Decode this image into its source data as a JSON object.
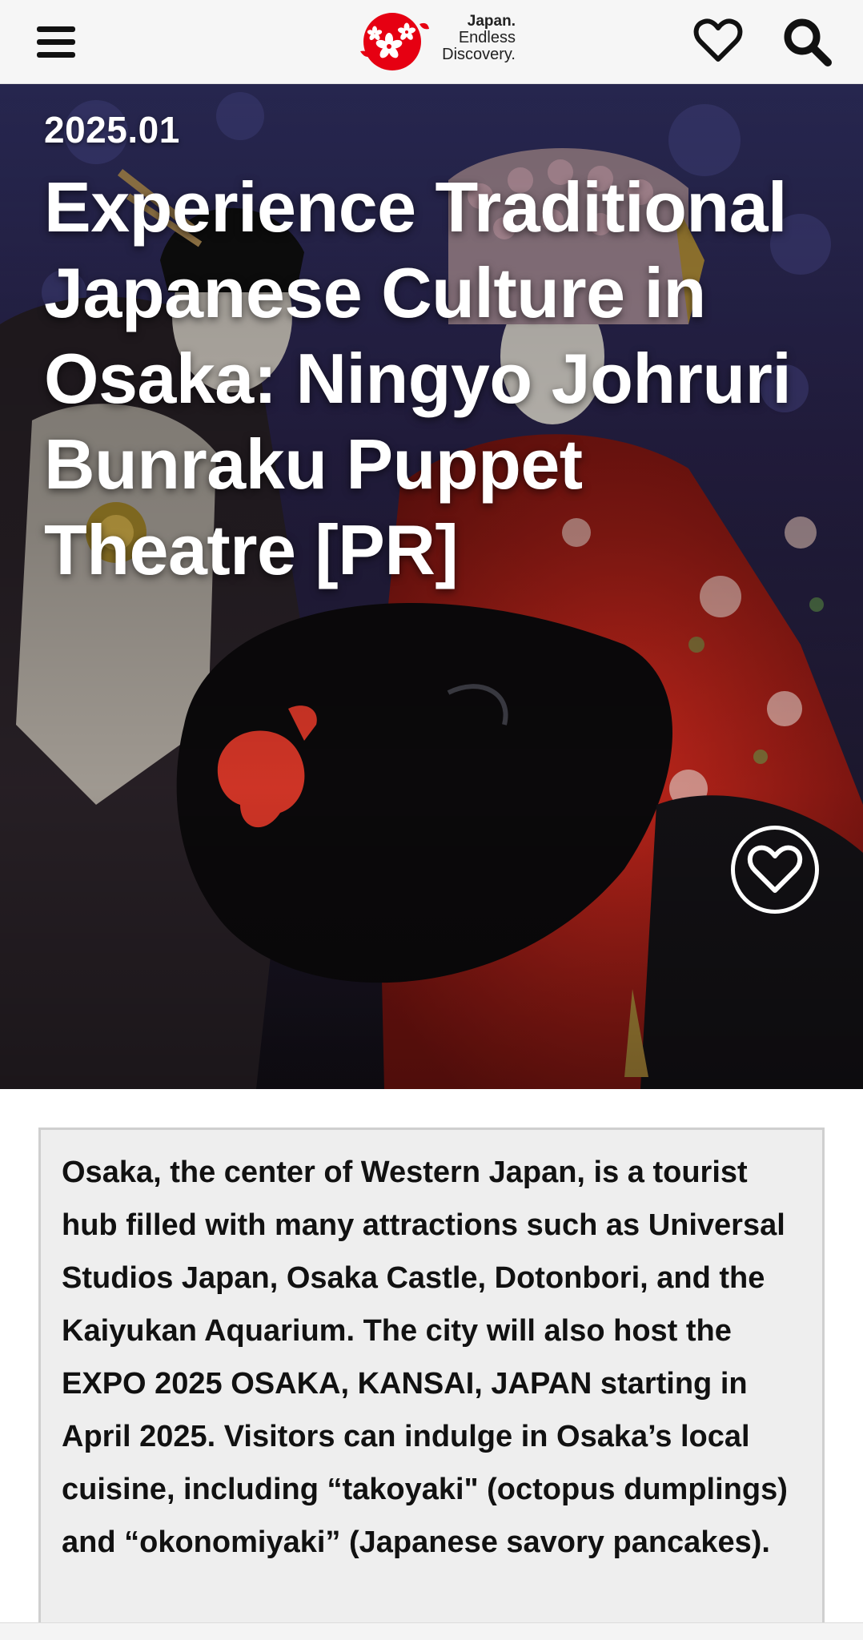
{
  "header": {
    "logo": {
      "line1": "Japan.",
      "line2": "Endless",
      "line3": "Discovery.",
      "mark_color": "#e60012"
    },
    "icons": {
      "menu": "hamburger-icon",
      "favorites": "heart-outline-icon",
      "search": "search-icon"
    }
  },
  "hero": {
    "date": "2025.01",
    "title": "Experience Traditional Japanese Culture in Osaka: Ningyo Johruri Bunraku Puppet Theatre [PR]",
    "favorite_icon": "heart-outline-icon"
  },
  "intro": {
    "text": "Osaka, the center of Western Japan, is a tourist hub filled with many attractions such as Universal Studios Japan, Osaka Castle, Dotonbori, and the Kaiyukan Aquarium. The city will also host the EXPO 2025 OSAKA, KANSAI, JAPAN starting in April 2025. Visitors can indulge in Osaka’s local cuisine, including “takoyaki\" (octopus dumplings) and “okonomiyaki” (Japanese savory pancakes)."
  },
  "colors": {
    "brand_red": "#e60012",
    "header_bg": "#f6f6f6",
    "intro_bg": "#eeeeee",
    "text": "#111111"
  }
}
